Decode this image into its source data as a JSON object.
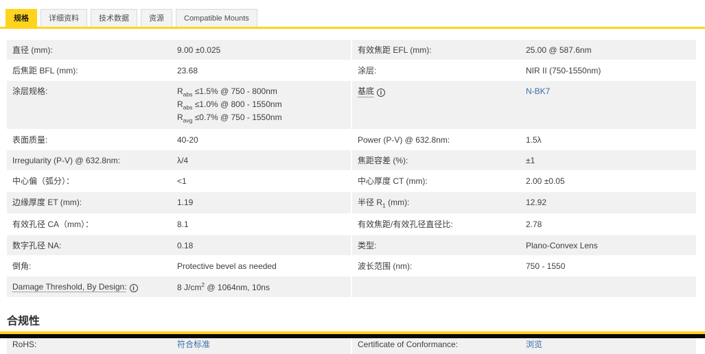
{
  "colors": {
    "accent_yellow": "#ffd41c",
    "link_blue": "#3a6fa8",
    "row_shade": "#f1f1f1",
    "text": "#3d3d3d",
    "footer_black": "#0a0a0a"
  },
  "tabs": [
    {
      "label": "规格",
      "active": true
    },
    {
      "label": "详细资料",
      "active": false
    },
    {
      "label": "技术数据",
      "active": false
    },
    {
      "label": "资源",
      "active": false
    },
    {
      "label": "Compatible Mounts",
      "active": false
    }
  ],
  "spec_rows": [
    {
      "left": {
        "label": "直径 (mm):",
        "value": "9.00 ±0.025"
      },
      "right": {
        "label": "有效焦距 EFL (mm):",
        "value": "25.00 @ 587.6nm"
      }
    },
    {
      "left": {
        "label": "后焦距 BFL (mm):",
        "value": "23.68"
      },
      "right": {
        "label": "涂层:",
        "value": "NIR II (750-1550nm)"
      }
    },
    {
      "left": {
        "label": "涂层规格:",
        "lines": [
          "R_{abs} ≤1.5% @ 750 - 800nm",
          "R_{abs} ≤1.0% @ 800 - 1550nm",
          "R_{avg} ≤0.7% @ 750 - 1550nm"
        ]
      },
      "right": {
        "label": "基底",
        "info": true,
        "value": "N-BK7",
        "link": true
      }
    },
    {
      "left": {
        "label": "表面质量:",
        "value": "40-20"
      },
      "right": {
        "label": "Power (P-V) @ 632.8nm:",
        "value": "1.5λ"
      }
    },
    {
      "left": {
        "label": "Irregularity (P-V) @ 632.8nm:",
        "value": "λ/4"
      },
      "right": {
        "label": "焦距容差 (%):",
        "value": "±1"
      }
    },
    {
      "left": {
        "label": "中心偏（弧分）：",
        "value": "<1"
      },
      "right": {
        "label": "中心厚度 CT (mm):",
        "value": "2.00 ±0.05"
      }
    },
    {
      "left": {
        "label": "边缘厚度 ET (mm):",
        "value": "1.19"
      },
      "right": {
        "label": "半径 R_{1} (mm):",
        "value": "12.92"
      }
    },
    {
      "left": {
        "label": "有效孔径 CA（mm）：",
        "value": "8.1"
      },
      "right": {
        "label": "有效焦距/有效孔径直径比:",
        "value": "2.78"
      }
    },
    {
      "left": {
        "label": "数字孔径 NA:",
        "value": "0.18"
      },
      "right": {
        "label": "类型:",
        "value": "Plano-Convex Lens"
      }
    },
    {
      "left": {
        "label": "倒角:",
        "value": "Protective bevel as needed"
      },
      "right": {
        "label": "波长范围 (nm):",
        "value": "750 - 1550"
      }
    },
    {
      "left": {
        "label": "Damage Threshold, By Design:",
        "info": true,
        "value": "8 J/cm^{2} @ 1064nm, 10ns"
      },
      "right": {
        "label": "",
        "value": ""
      }
    }
  ],
  "compliance": {
    "heading": "合规性",
    "row": {
      "left": {
        "label": "RoHS:",
        "value": "符合标准",
        "link": true
      },
      "right": {
        "label": "Certificate of Conformance:",
        "value": "浏览",
        "link": true
      }
    }
  }
}
